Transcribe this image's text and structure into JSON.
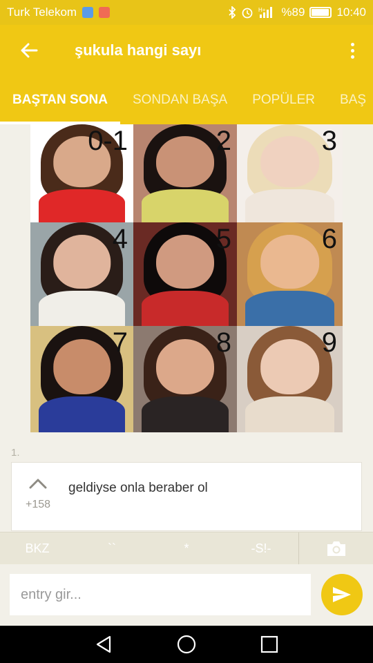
{
  "status_bar": {
    "carrier": "Turk Telekom",
    "battery_text": "%89",
    "battery_level": 0.89,
    "time": "10:40",
    "network": "H+"
  },
  "app_bar": {
    "title": "şukula hangi sayı",
    "back_icon": "arrow-left-icon",
    "menu_icon": "more-vert-icon"
  },
  "tabs": [
    {
      "label": "BAŞTAN SONA",
      "active": true
    },
    {
      "label": "SONDAN BAŞA",
      "active": false
    },
    {
      "label": "POPÜLER",
      "active": false
    },
    {
      "label": "BAŞ",
      "active": false
    }
  ],
  "image_grid": {
    "labels": [
      "0-1",
      "2",
      "3",
      "4",
      "5",
      "6",
      "7",
      "8",
      "9"
    ]
  },
  "entry": {
    "index": "1.",
    "text": "geldiyse onla beraber ol",
    "votes": "+158"
  },
  "toolbar": {
    "bkz": "BKZ",
    "backtick": "``",
    "star": "*",
    "spoiler": "-S!-",
    "camera_icon": "camera-icon"
  },
  "input": {
    "placeholder": "entry gir..."
  },
  "colors": {
    "accent": "#f0c814",
    "background": "#f2f0e8"
  }
}
